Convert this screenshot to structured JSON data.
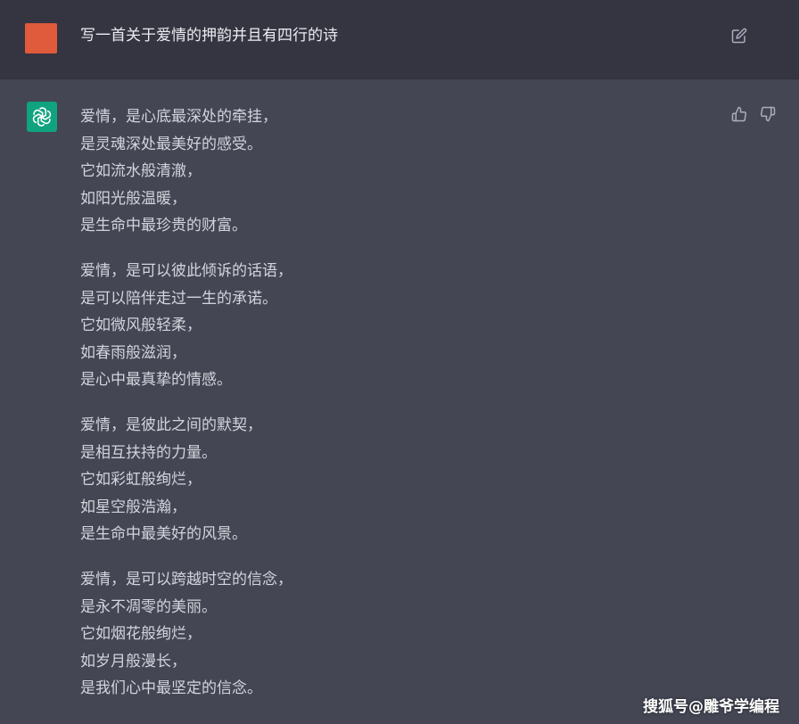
{
  "user_message": {
    "text": "写一首关于爱情的押韵并且有四行的诗"
  },
  "assistant_message": {
    "stanzas": [
      {
        "lines": [
          "爱情，是心底最深处的牵挂，",
          "是灵魂深处最美好的感受。",
          "它如流水般清澈，",
          "如阳光般温暖，",
          "是生命中最珍贵的财富。"
        ]
      },
      {
        "lines": [
          "爱情，是可以彼此倾诉的话语，",
          "是可以陪伴走过一生的承诺。",
          "它如微风般轻柔，",
          "如春雨般滋润，",
          "是心中最真挚的情感。"
        ]
      },
      {
        "lines": [
          "爱情，是彼此之间的默契，",
          "是相互扶持的力量。",
          "它如彩虹般绚烂，",
          "如星空般浩瀚，",
          "是生命中最美好的风景。"
        ]
      },
      {
        "lines": [
          "爱情，是可以跨越时空的信念，",
          "是永不凋零的美丽。",
          "它如烟花般绚烂，",
          "如岁月般漫长，",
          "是我们心中最坚定的信念。"
        ]
      }
    ]
  },
  "icons": {
    "edit": "edit-icon",
    "thumbs_up": "thumbs-up-icon",
    "thumbs_down": "thumbs-down-icon",
    "assistant": "openai-logo-icon"
  },
  "watermark": "搜狐号@雕爷学编程",
  "colors": {
    "user_avatar": "#e05a3c",
    "assistant_avatar": "#10a37f",
    "user_row_bg": "#343541",
    "assistant_row_bg": "#444654"
  }
}
